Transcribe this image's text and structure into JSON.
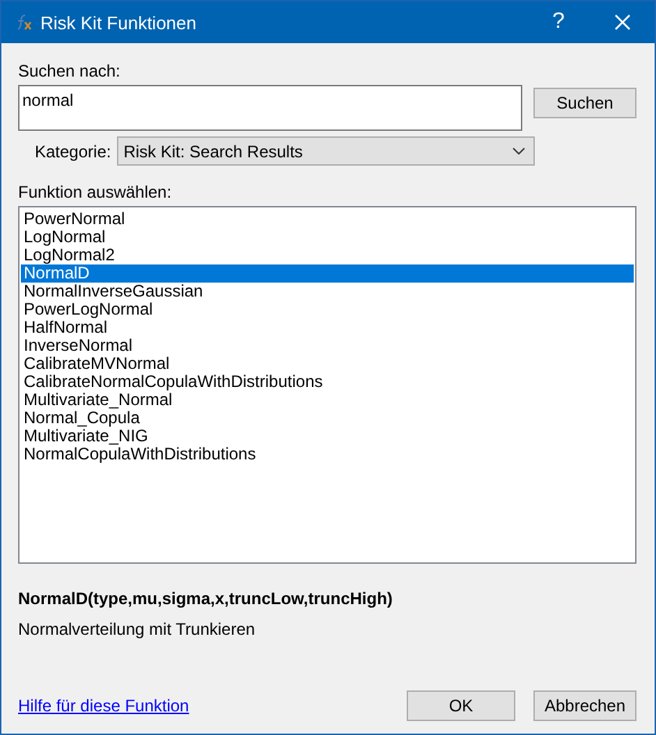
{
  "window": {
    "title": "Risk Kit Funktionen",
    "help_button": "?"
  },
  "search": {
    "label": "Suchen nach:",
    "value": "normal",
    "button": "Suchen"
  },
  "category": {
    "label": "Kategorie:",
    "value": "Risk Kit: Search Results"
  },
  "functions": {
    "label": "Funktion auswählen:",
    "items": [
      {
        "name": "PowerNormal",
        "selected": false
      },
      {
        "name": "LogNormal",
        "selected": false
      },
      {
        "name": "LogNormal2",
        "selected": false
      },
      {
        "name": "NormalD",
        "selected": true
      },
      {
        "name": "NormalInverseGaussian",
        "selected": false
      },
      {
        "name": "PowerLogNormal",
        "selected": false
      },
      {
        "name": "HalfNormal",
        "selected": false
      },
      {
        "name": "InverseNormal",
        "selected": false
      },
      {
        "name": "CalibrateMVNormal",
        "selected": false
      },
      {
        "name": "CalibrateNormalCopulaWithDistributions",
        "selected": false
      },
      {
        "name": "Multivariate_Normal",
        "selected": false
      },
      {
        "name": "Normal_Copula",
        "selected": false
      },
      {
        "name": "Multivariate_NIG",
        "selected": false
      },
      {
        "name": "NormalCopulaWithDistributions",
        "selected": false
      }
    ]
  },
  "signature": "NormalD(type,mu,sigma,x,truncLow,truncHigh)",
  "description": "Normalverteilung mit Trunkieren",
  "help_link": "Hilfe für diese Funktion",
  "buttons": [
    "OK",
    "Abbrechen"
  ]
}
